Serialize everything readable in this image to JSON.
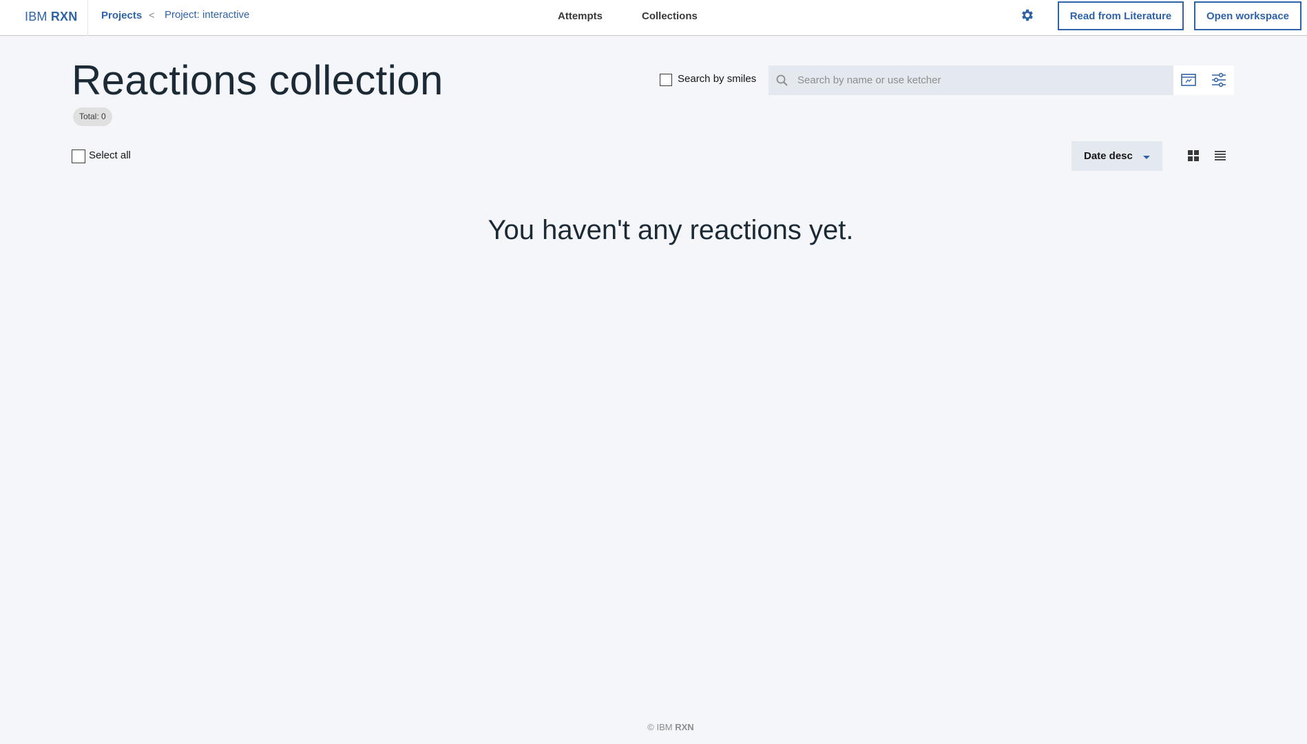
{
  "header": {
    "brand_light": "IBM",
    "brand_bold": "RXN",
    "breadcrumb": {
      "projects": "Projects",
      "separator": "<",
      "current": "Project: interactive"
    },
    "nav": {
      "attempts": "Attempts",
      "collections": "Collections"
    },
    "settings_icon": "gear-icon",
    "read_literature_label": "Read from Literature",
    "open_workspace_label": "Open workspace"
  },
  "page": {
    "title": "Reactions collection",
    "total_tag": "Total: 0"
  },
  "search": {
    "smiles_checkbox_label": "Search by smiles",
    "smiles_checked": false,
    "placeholder": "Search by name or use ketcher",
    "value": ""
  },
  "controls": {
    "select_all_label": "Select all",
    "select_all_checked": false,
    "sort_label": "Date desc",
    "view_modes": [
      "grid-view-icon",
      "list-view-icon"
    ]
  },
  "empty_state": {
    "message": "You haven't any reactions yet."
  },
  "footer": {
    "copyright_symbol": "©",
    "brand_light": "IBM",
    "brand_bold": "RXN"
  },
  "colors": {
    "accent": "#2f63a8",
    "background": "#f4f6fa",
    "header_bg": "#ffffff",
    "field_bg": "#e4e8ef",
    "title_text": "#1c2a36"
  }
}
